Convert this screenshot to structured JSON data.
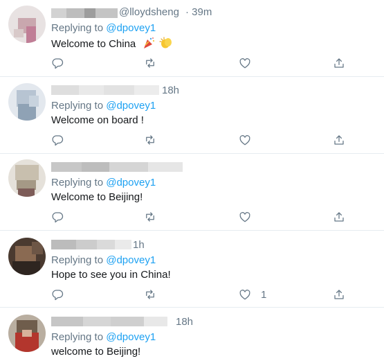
{
  "tweets": [
    {
      "handle": "@lloydsheng",
      "time": "· 39m",
      "reply_prefix": "Replying to",
      "reply_to": "@dpovey1",
      "text": "Welcome to China",
      "emoji": [
        "party-popper-icon",
        "clapping-hands-icon"
      ],
      "like_count": ""
    },
    {
      "handle": "",
      "time": "18h",
      "reply_prefix": "Replying to",
      "reply_to": "@dpovey1",
      "text": "Welcome on board !",
      "like_count": ""
    },
    {
      "handle": "",
      "time": "",
      "reply_prefix": "Replying to",
      "reply_to": "@dpovey1",
      "text": "Welcome to Beijing!",
      "like_count": ""
    },
    {
      "handle": "",
      "time": "1h",
      "reply_prefix": "Replying to",
      "reply_to": "@dpovey1",
      "text": "Hope to see you in China!",
      "like_count": "1"
    },
    {
      "handle": "",
      "time": "18h",
      "reply_prefix": "Replying to",
      "reply_to": "@dpovey1",
      "text": "welcome to Beijing!",
      "like_count": ""
    }
  ],
  "icons": {
    "reply": "reply-icon",
    "retweet": "retweet-icon",
    "like": "like-icon",
    "share": "share-icon"
  },
  "colors": {
    "mention": "#1da1f2",
    "secondary_text": "#657786",
    "divider": "#e6ecf0"
  }
}
